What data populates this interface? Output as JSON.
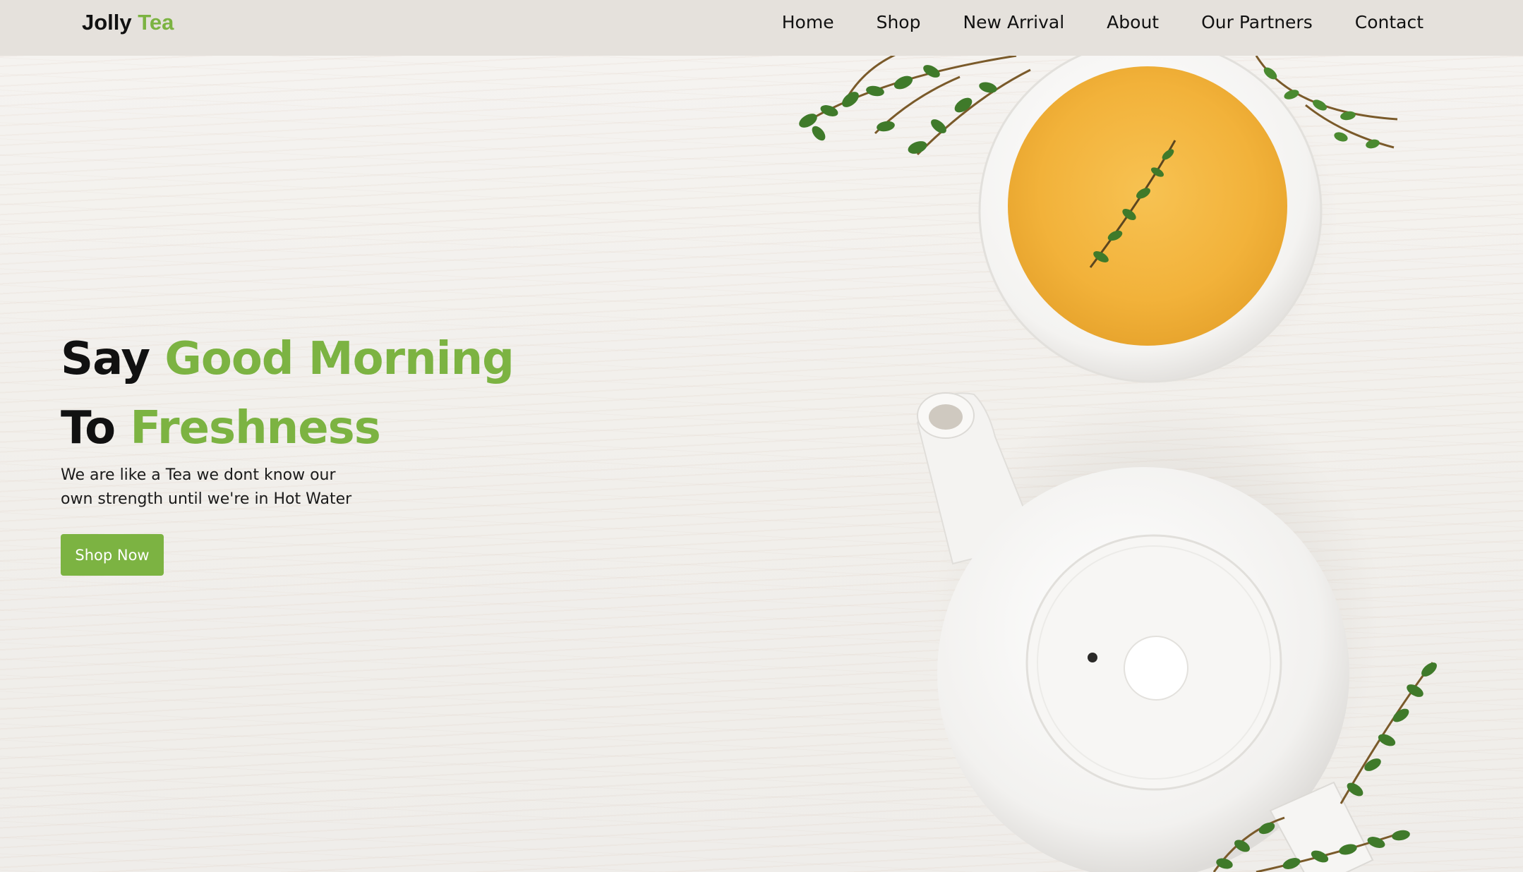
{
  "brand": {
    "logo_part1": "Jolly",
    "logo_part2": "Tea",
    "accent_color": "#7cb342"
  },
  "nav": {
    "items": [
      {
        "label": "Home"
      },
      {
        "label": "Shop"
      },
      {
        "label": "New Arrival"
      },
      {
        "label": "About"
      },
      {
        "label": "Our Partners"
      },
      {
        "label": "Contact"
      }
    ]
  },
  "hero": {
    "line1_word1": "Say",
    "line1_word2": "Good Morning",
    "line2_word1": "To",
    "line2_word2": "Freshness",
    "tagline_line1": "We are like a Tea we dont know our",
    "tagline_line2": "own strength until we're in Hot Water",
    "cta_label": "Shop Now",
    "image_icons": [
      "tea-cup-icon",
      "teapot-icon",
      "thyme-sprig-icon"
    ]
  },
  "colors": {
    "navbar_bg": "#e5e1dc",
    "text_dark": "#111111",
    "tea_liquid": "#f2b23a"
  }
}
